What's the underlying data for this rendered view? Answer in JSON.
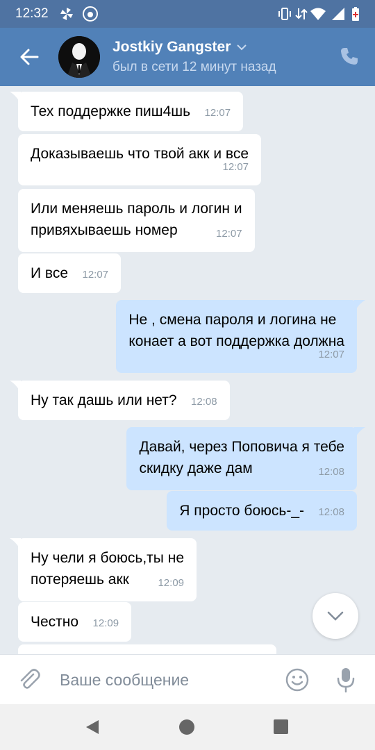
{
  "status": {
    "time": "12:32"
  },
  "header": {
    "title": "Jostkiy Gangster",
    "subtitle": "был в сети 12 минут назад"
  },
  "messages": [
    {
      "dir": "in",
      "tail": true,
      "text": "Тех поддержке пиш4шь",
      "time": "12:07"
    },
    {
      "dir": "in",
      "tail": false,
      "text": "Доказываешь что твой акк и все",
      "time": "12:07"
    },
    {
      "dir": "in",
      "tail": false,
      "text": "Или меняешь пароль и логин и\nпривяхываешь номер",
      "time": "12:07"
    },
    {
      "dir": "in",
      "tail": false,
      "text": "И все",
      "time": "12:07"
    },
    {
      "dir": "out",
      "tail": true,
      "text": "Не , смена пароля и логина не\nконает а вот поддержка должна",
      "time": "12:07"
    },
    {
      "dir": "in",
      "tail": true,
      "text": "Ну так дашь или нет?",
      "time": "12:08"
    },
    {
      "dir": "out",
      "tail": true,
      "text": "Давай, через Поповича я тебе\nскидку даже дам",
      "time": "12:08"
    },
    {
      "dir": "out",
      "tail": false,
      "text": "Я просто боюсь-_-",
      "time": "12:08"
    },
    {
      "dir": "in",
      "tail": true,
      "text": "Ну чели я боюсь,ты не\nпотеряешь акк",
      "time": "12:09"
    },
    {
      "dir": "in",
      "tail": false,
      "text": "Честно",
      "time": "12:09"
    }
  ],
  "composer": {
    "placeholder": "Ваше сообщение"
  },
  "colors": {
    "header": "#5181b8",
    "statusbar": "#4f73a2",
    "incoming": "#ffffff",
    "outgoing": "#cce4ff",
    "background": "#e6ebf0"
  },
  "icons": [
    "back-arrow-icon",
    "chevron-down-icon",
    "phone-icon",
    "scroll-down-icon",
    "paperclip-icon",
    "smile-icon",
    "microphone-icon"
  ]
}
